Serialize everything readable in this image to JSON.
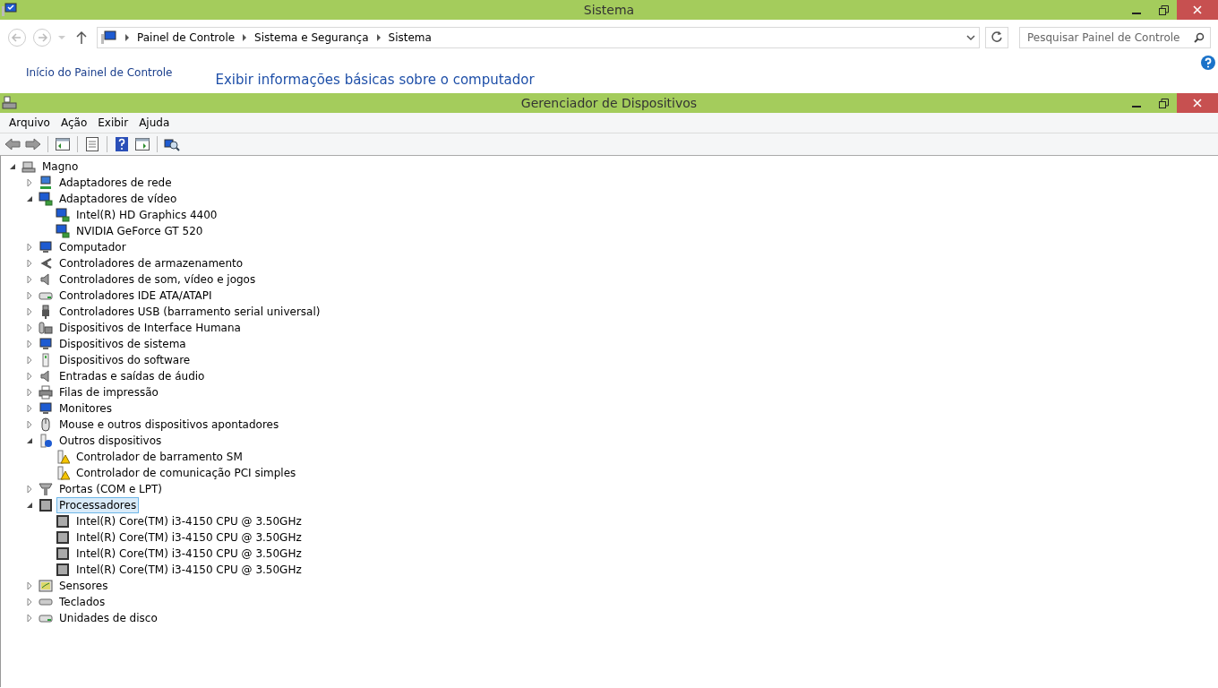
{
  "system_window": {
    "title": "Sistema",
    "breadcrumb": [
      "Painel de Controle",
      "Sistema e Segurança",
      "Sistema"
    ],
    "search": {
      "placeholder": "Pesquisar Painel de Controle"
    },
    "sidebar_link": "Início do Painel de Controle",
    "heading": "Exibir informações básicas sobre o computador"
  },
  "device_manager": {
    "title": "Gerenciador de Dispositivos",
    "menu": [
      "Arquivo",
      "Ação",
      "Exibir",
      "Ajuda"
    ],
    "tree": [
      {
        "label": "Magno",
        "kind": "computer",
        "expanded": true,
        "selected": false,
        "children": [
          {
            "label": "Adaptadores de rede",
            "kind": "network",
            "expanded": false,
            "selected": false
          },
          {
            "label": "Adaptadores de vídeo",
            "kind": "display",
            "expanded": true,
            "selected": false,
            "children": [
              {
                "label": "Intel(R) HD Graphics 4400",
                "kind": "display",
                "selected": false
              },
              {
                "label": "NVIDIA GeForce GT 520",
                "kind": "display",
                "selected": false
              }
            ]
          },
          {
            "label": "Computador",
            "kind": "monitor",
            "expanded": false,
            "selected": false
          },
          {
            "label": "Controladores de armazenamento",
            "kind": "storage",
            "expanded": false,
            "selected": false
          },
          {
            "label": "Controladores de som, vídeo e jogos",
            "kind": "speaker",
            "expanded": false,
            "selected": false
          },
          {
            "label": "Controladores IDE ATA/ATAPI",
            "kind": "drive",
            "expanded": false,
            "selected": false
          },
          {
            "label": "Controladores USB (barramento serial universal)",
            "kind": "usb",
            "expanded": false,
            "selected": false
          },
          {
            "label": "Dispositivos de Interface Humana",
            "kind": "hid",
            "expanded": false,
            "selected": false
          },
          {
            "label": "Dispositivos de sistema",
            "kind": "monitor",
            "expanded": false,
            "selected": false
          },
          {
            "label": "Dispositivos do software",
            "kind": "software",
            "expanded": false,
            "selected": false
          },
          {
            "label": "Entradas e saídas de áudio",
            "kind": "speaker",
            "expanded": false,
            "selected": false
          },
          {
            "label": "Filas de impressão",
            "kind": "printer",
            "expanded": false,
            "selected": false
          },
          {
            "label": "Monitores",
            "kind": "monitor",
            "expanded": false,
            "selected": false
          },
          {
            "label": "Mouse e outros dispositivos apontadores",
            "kind": "mouse",
            "expanded": false,
            "selected": false
          },
          {
            "label": "Outros dispositivos",
            "kind": "unknown",
            "expanded": true,
            "selected": false,
            "children": [
              {
                "label": "Controlador de barramento SM",
                "kind": "warning",
                "selected": false
              },
              {
                "label": "Controlador de comunicação PCI simples",
                "kind": "warning",
                "selected": false
              }
            ]
          },
          {
            "label": "Portas (COM e LPT)",
            "kind": "port",
            "expanded": false,
            "selected": false
          },
          {
            "label": "Processadores",
            "kind": "chip",
            "expanded": true,
            "selected": true,
            "children": [
              {
                "label": "Intel(R) Core(TM) i3-4150 CPU @ 3.50GHz",
                "kind": "chip",
                "selected": false
              },
              {
                "label": "Intel(R) Core(TM) i3-4150 CPU @ 3.50GHz",
                "kind": "chip",
                "selected": false
              },
              {
                "label": "Intel(R) Core(TM) i3-4150 CPU @ 3.50GHz",
                "kind": "chip",
                "selected": false
              },
              {
                "label": "Intel(R) Core(TM) i3-4150 CPU @ 3.50GHz",
                "kind": "chip",
                "selected": false
              }
            ]
          },
          {
            "label": "Sensores",
            "kind": "sensor",
            "expanded": false,
            "selected": false
          },
          {
            "label": "Teclados",
            "kind": "keyboard",
            "expanded": false,
            "selected": false
          },
          {
            "label": "Unidades de disco",
            "kind": "drive",
            "expanded": false,
            "selected": false
          }
        ]
      }
    ]
  }
}
